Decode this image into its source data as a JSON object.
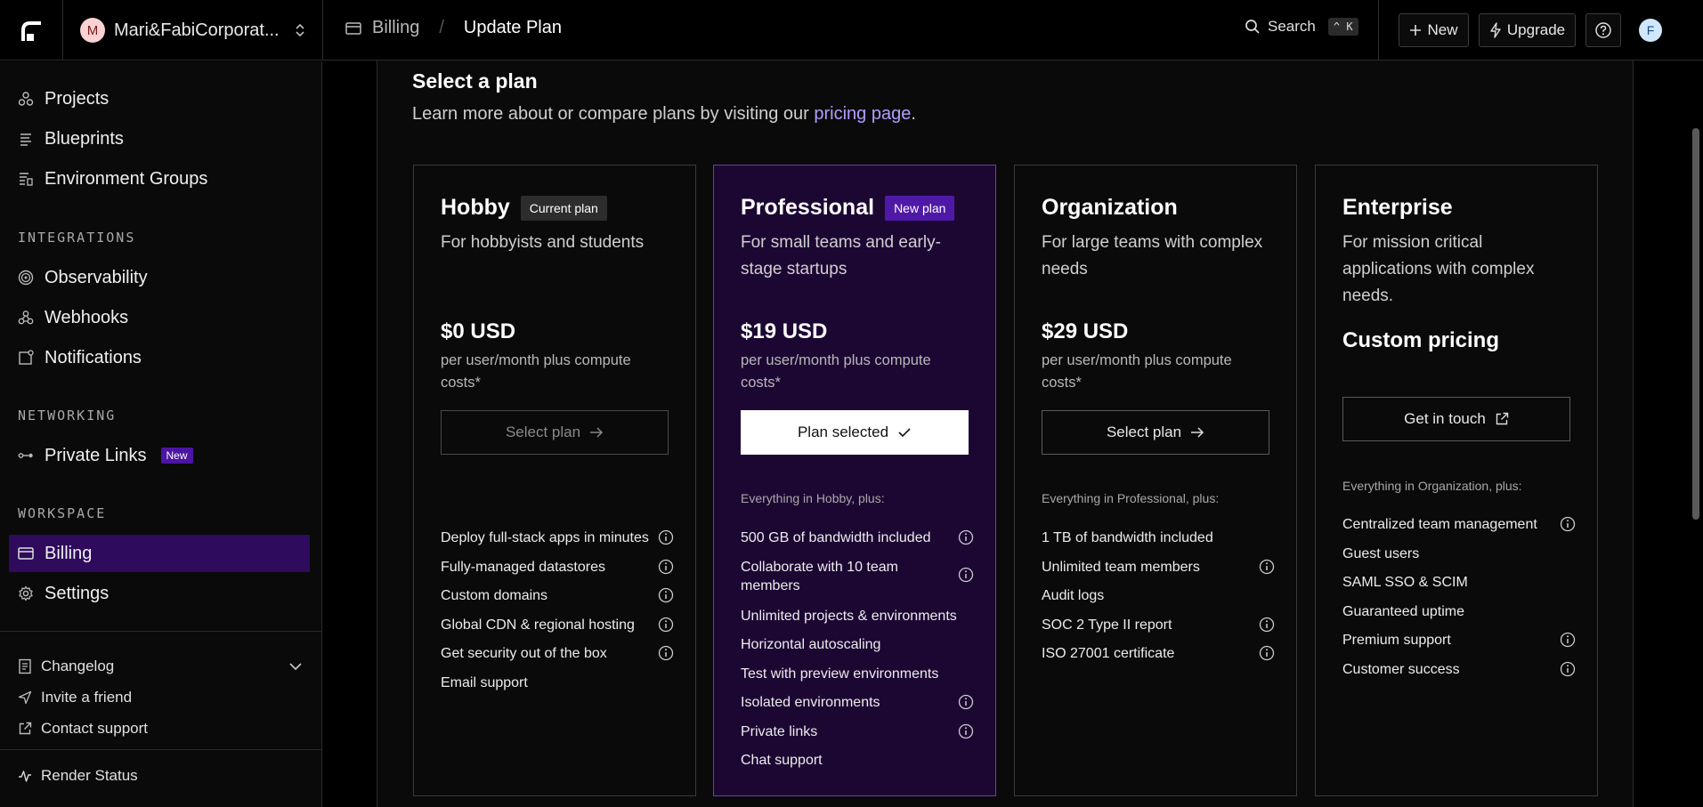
{
  "topbar": {
    "workspace_initial": "M",
    "workspace_name": "Mari&FabiCorporat...",
    "crumb_billing": "Billing",
    "crumb_sep": "/",
    "crumb_current": "Update Plan",
    "search_label": "Search",
    "search_kbd": "^ K",
    "new_label": "New",
    "upgrade_label": "Upgrade",
    "user_initial": "F"
  },
  "sidebar": {
    "projects": "Projects",
    "blueprints": "Blueprints",
    "env_groups": "Environment Groups",
    "integrations_heading": "INTEGRATIONS",
    "observability": "Observability",
    "webhooks": "Webhooks",
    "notifications": "Notifications",
    "networking_heading": "NETWORKING",
    "private_links": "Private Links",
    "private_links_badge": "New",
    "workspace_heading": "WORKSPACE",
    "billing": "Billing",
    "settings": "Settings",
    "changelog": "Changelog",
    "invite": "Invite a friend",
    "contact": "Contact support",
    "render_status": "Render Status"
  },
  "main": {
    "title": "Select a plan",
    "subtitle_prefix": "Learn more about or compare plans by visiting our ",
    "subtitle_link": "pricing page",
    "subtitle_suffix": "."
  },
  "plans": {
    "hobby": {
      "name": "Hobby",
      "badge": "Current plan",
      "desc": "For hobbyists and students",
      "price": "$0 USD",
      "price_sub": "per user/month plus compute costs*",
      "button": "Select plan",
      "features": [
        "Deploy full-stack apps in minutes",
        "Fully-managed datastores",
        "Custom domains",
        "Global CDN & regional hosting",
        "Get security out of the box",
        "Email support"
      ]
    },
    "pro": {
      "name": "Professional",
      "badge": "New plan",
      "desc": "For small teams and early-stage startups",
      "price": "$19 USD",
      "price_sub": "per user/month plus compute costs*",
      "button": "Plan selected",
      "plus": "Everything in Hobby, plus:",
      "features": [
        "500 GB of bandwidth included",
        "Collaborate with 10 team members",
        "Unlimited projects & environments",
        "Horizontal autoscaling",
        "Test with preview environments",
        "Isolated environments",
        "Private links",
        "Chat support"
      ]
    },
    "org": {
      "name": "Organization",
      "desc": "For large teams with complex needs",
      "price": "$29 USD",
      "price_sub": "per user/month plus compute costs*",
      "button": "Select plan",
      "plus": "Everything in Professional, plus:",
      "features": [
        "1 TB of bandwidth included",
        "Unlimited team members",
        "Audit logs",
        "SOC 2 Type II report",
        "ISO 27001 certificate"
      ]
    },
    "ent": {
      "name": "Enterprise",
      "desc": "For mission critical applications with complex needs.",
      "price": "Custom pricing",
      "button": "Get in touch",
      "plus": "Everything in Organization, plus:",
      "features": [
        "Centralized team management",
        "Guest users",
        "SAML SSO & SCIM",
        "Guaranteed uptime",
        "Premium support",
        "Customer success"
      ]
    }
  },
  "colors": {
    "accent": "#4b14a3",
    "active_nav": "#2e0b5c",
    "pro_card": "#1c0733",
    "link": "#b69cff"
  }
}
